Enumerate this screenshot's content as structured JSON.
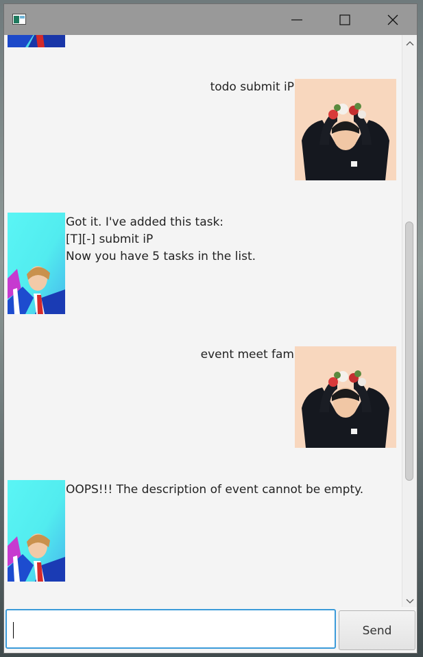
{
  "window": {
    "colors": {
      "titlebar": "#999999",
      "accent": "#3a9ad9",
      "content": "#f4f4f4"
    }
  },
  "messages": [
    {
      "sender": "user",
      "text": "todo submit iP"
    },
    {
      "sender": "bot",
      "text": "Got it. I've added this task:\n[T][-] submit iP\nNow you have 5 tasks in the list."
    },
    {
      "sender": "user",
      "text": "event meet fam"
    },
    {
      "sender": "bot",
      "text": "OOPS!!! The description of event cannot be empty."
    }
  ],
  "input": {
    "value": "",
    "placeholder": ""
  },
  "send_button": {
    "label": "Send"
  },
  "icons": [
    "app-icon",
    "minimize-icon",
    "maximize-icon",
    "close-icon",
    "scroll-up-arrow-icon",
    "scroll-down-arrow-icon",
    "bot-avatar",
    "user-avatar"
  ]
}
